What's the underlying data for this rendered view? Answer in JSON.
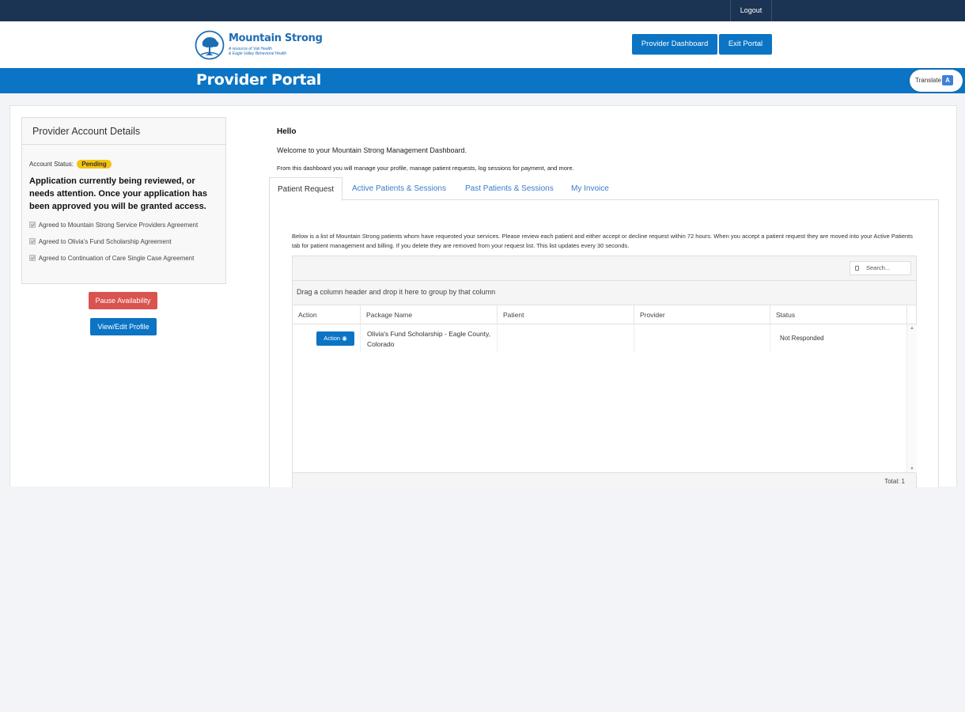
{
  "topbar": {
    "logout_label": "Logout"
  },
  "header": {
    "logo_title": "Mountain Strong",
    "logo_subtitle_1": "A resource of Vail Health",
    "logo_subtitle_2": "& Eagle Valley Behavioral Health",
    "provider_dashboard_label": "Provider Dashboard",
    "exit_portal_label": "Exit Portal"
  },
  "band": {
    "title": "Provider Portal",
    "translate_label": "Translate"
  },
  "account": {
    "heading": "Provider Account Details",
    "status_label": "Account Status:",
    "status_value": "Pending",
    "review_message": "Application currently being reviewed, or needs attention. Once your application has been approved you will be granted access.",
    "agreements": [
      "Agreed to Mountain Strong Service Providers Agreement",
      "Agreed to Olivia's Fund Scholarship Agreement",
      "Agreed to Continuation of Care Single Case Agreement"
    ],
    "pause_label": "Pause Availability",
    "edit_label": "View/Edit Profile"
  },
  "dashboard": {
    "hello": "Hello",
    "welcome": "Welcome to your Mountain Strong Management Dashboard.",
    "description": "From this dashboard you will manage your profile, manage patient requests, log sessions for payment, and more.",
    "tabs": [
      "Patient Request",
      "Active Patients & Sessions",
      "Past Patients & Sessions",
      "My Invoice"
    ]
  },
  "requests": {
    "instructions": "Below is a list of Mountain Strong patients whom have requested your services. Please review each patient and either accept or decline request within 72 hours. When you accept a patient request they are moved into your Active Patients tab for patient management and billing. If you delete they are removed from your request list. This list updates every 30 seconds.",
    "search_placeholder": "Search...",
    "group_hint": "Drag a column header and drop it here to group by that column",
    "columns": [
      "Action",
      "Package Name",
      "Patient",
      "Provider",
      "Status"
    ],
    "rows": [
      {
        "action": "Action",
        "package": "Olivia's Fund Scholarship - Eagle County, Colorado",
        "patient": "",
        "provider": "",
        "status": "Not Responded"
      }
    ],
    "total": "Total: 1"
  },
  "colors": {
    "navy": "#1c3453",
    "brand_blue": "#0b74c4",
    "danger": "#d9534f",
    "pending": "#f4c40f"
  }
}
